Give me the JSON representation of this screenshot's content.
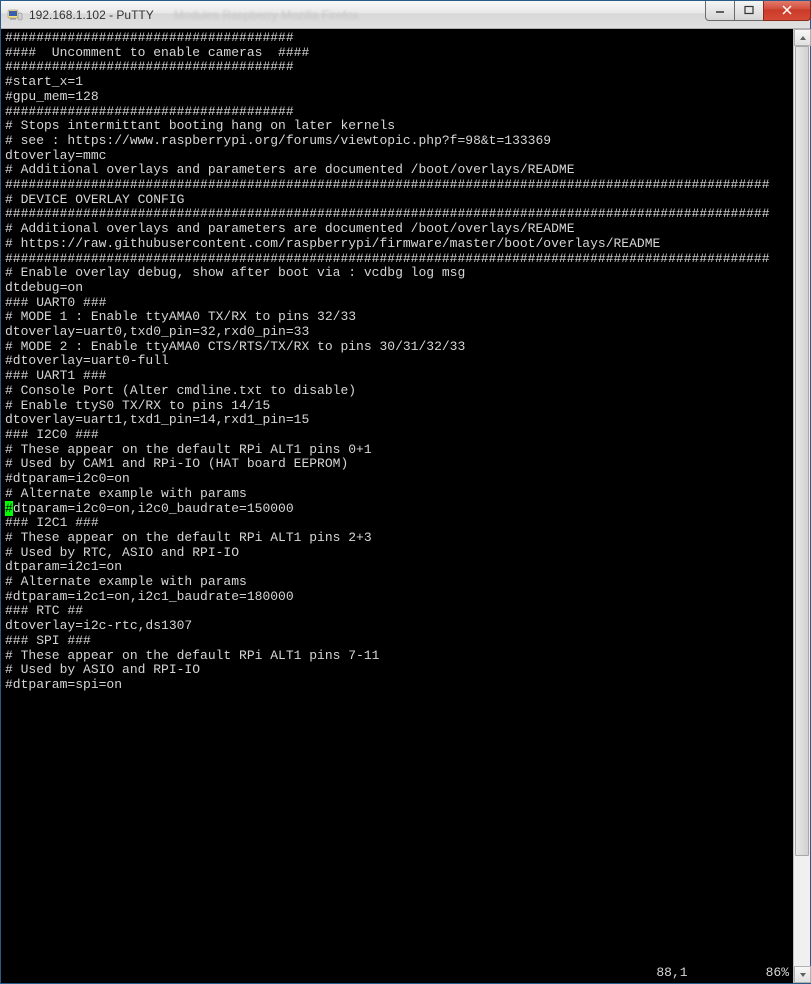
{
  "window": {
    "title": "192.168.1.102 - PuTTY",
    "background_tab": "Modules              Raspberry            Mozilla Firefox"
  },
  "terminal": {
    "lines": [
      "#####################################",
      "####  Uncomment to enable cameras  ####",
      "#####################################",
      "#start_x=1",
      "#gpu_mem=128",
      "#####################################",
      "",
      "# Stops intermittant booting hang on later kernels",
      "# see : https://www.raspberrypi.org/forums/viewtopic.php?f=98&t=133369",
      "dtoverlay=mmc",
      "",
      "# Additional overlays and parameters are documented /boot/overlays/README",
      "##################################################################################################",
      "# DEVICE OVERLAY CONFIG",
      "##################################################################################################",
      "# Additional overlays and parameters are documented /boot/overlays/README",
      "# https://raw.githubusercontent.com/raspberrypi/firmware/master/boot/overlays/README",
      "##################################################################################################",
      "",
      "# Enable overlay debug, show after boot via : vcdbg log msg",
      "dtdebug=on",
      "",
      "### UART0 ###",
      "# MODE 1 : Enable ttyAMA0 TX/RX to pins 32/33",
      "dtoverlay=uart0,txd0_pin=32,rxd0_pin=33",
      "",
      "# MODE 2 : Enable ttyAMA0 CTS/RTS/TX/RX to pins 30/31/32/33",
      "#dtoverlay=uart0-full",
      "",
      "",
      "### UART1 ###",
      "# Console Port (Alter cmdline.txt to disable)",
      "# Enable ttyS0 TX/RX to pins 14/15",
      "dtoverlay=uart1,txd1_pin=14,rxd1_pin=15",
      "",
      "",
      "### I2C0 ###",
      "# These appear on the default RPi ALT1 pins 0+1",
      "# Used by CAM1 and RPi-IO (HAT board EEPROM)",
      "#dtparam=i2c0=on",
      "# Alternate example with params",
      "#dtparam=i2c0=on,i2c0_baudrate=150000",
      "",
      "",
      "### I2C1 ###",
      "# These appear on the default RPi ALT1 pins 2+3",
      "# Used by RTC, ASIO and RPI-IO",
      "dtparam=i2c1=on",
      "# Alternate example with params",
      "#dtparam=i2c1=on,i2c1_baudrate=180000",
      "",
      "### RTC ##",
      "dtoverlay=i2c-rtc,ds1307",
      "",
      "### SPI ###",
      "# These appear on the default RPi ALT1 pins 7-11",
      "# Used by ASIO and RPI-IO",
      "#dtparam=spi=on"
    ],
    "cursor_line_index": 41,
    "cursor_col": 0,
    "status": "88,1          86%"
  }
}
